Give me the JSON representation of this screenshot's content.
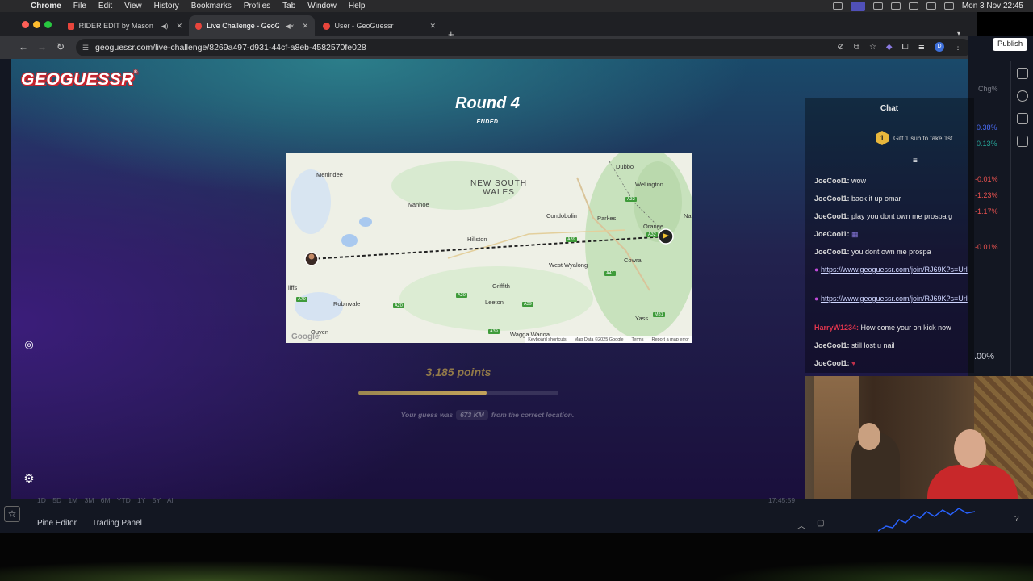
{
  "menubar": {
    "app": "Chrome",
    "items": [
      "File",
      "Edit",
      "View",
      "History",
      "Bookmarks",
      "Profiles",
      "Tab",
      "Window",
      "Help"
    ],
    "datetime": "Mon 3 Nov  22:45"
  },
  "tabs": [
    {
      "title": "RIDER EDIT by Mason Col",
      "active": false,
      "favicon_color": "#e8453c"
    },
    {
      "title": "Live Challenge - GeoGue",
      "active": true,
      "favicon_color": "#e8453c"
    },
    {
      "title": "User - GeoGuessr",
      "active": false,
      "favicon_color": "#e8453c"
    }
  ],
  "url": "geoguessr.com/live-challenge/8269a497-d931-44cf-a8eb-4582570fe028",
  "publish_label": "Publish",
  "tradingview": {
    "top_label": "Chg%",
    "values": [
      {
        "text": "0.38%",
        "color": "#4a6cf7"
      },
      {
        "text": "0.13%",
        "color": "#26a69a"
      },
      {
        "text": "-0.01%",
        "color": "#ef5350"
      },
      {
        "text": "-1.23%",
        "color": "#ef5350"
      },
      {
        "text": "-1.17%",
        "color": "#ef5350"
      },
      {
        "text": "-0.01%",
        "color": "#ef5350"
      },
      {
        "text": ".00%",
        "color": "#d1d4dc"
      }
    ],
    "timeframes": "1D 5D 1M 3M 6M YTD 1Y 5Y All",
    "time": "17:45:59",
    "bottom_panels": [
      "Pine Editor",
      "Trading Panel"
    ]
  },
  "game": {
    "logo": "GEOGUESSR",
    "round_title": "Round 4",
    "round_status": "ENDED",
    "points": "3,185 points",
    "progress_fraction": 0.64,
    "guess_prefix": "Your guess was",
    "distance": "673 KM",
    "guess_suffix": "from the correct location."
  },
  "map": {
    "region_label_line1": "NEW SOUTH",
    "region_label_line2": "WALES",
    "places": [
      "Menindee",
      "Ivanhoe",
      "Dubbo",
      "Wellington",
      "Condobolin",
      "Parkes",
      "Orange",
      "Hillston",
      "West Wyalong",
      "Cowra",
      "Griffith",
      "Leeton",
      "Robinvale",
      "Yass",
      "Wagga Wagga",
      "Ouyen",
      "liffs",
      "Na"
    ],
    "roads": [
      "A32",
      "A39",
      "A32",
      "A41",
      "A20",
      "A20",
      "A39",
      "A79",
      "M31",
      "A39"
    ],
    "footer": [
      "Keyboard shortcuts",
      "Map Data ©2025 Google",
      "Terms",
      "Report a map error"
    ],
    "watermark": "Google"
  },
  "chat": {
    "title": "Chat",
    "gift_rank": "1",
    "gift_text": "Gift 1 sub to take 1st",
    "messages": [
      {
        "user": "JoeCool1:",
        "text": "wow"
      },
      {
        "user": "JoeCool1:",
        "text": "back it up omar"
      },
      {
        "user": "JoeCool1:",
        "text": "play you dont own me prospa g"
      },
      {
        "user": "JoeCool1:",
        "text": ""
      },
      {
        "user": "JoeCool1:",
        "text": "you dont own me prospa"
      },
      {
        "user": "",
        "text": "https://www.geoguessr.com/join/RJ69K?s=Url"
      },
      {
        "user": "",
        "text": "https://www.geoguessr.com/join/RJ69K?s=Url"
      },
      {
        "user": "HarryW1234:",
        "text": "How come your on kick now"
      },
      {
        "user": "JoeCool1:",
        "text": "still lost u nail"
      },
      {
        "user": "JoeCool1:",
        "text": ""
      }
    ]
  }
}
